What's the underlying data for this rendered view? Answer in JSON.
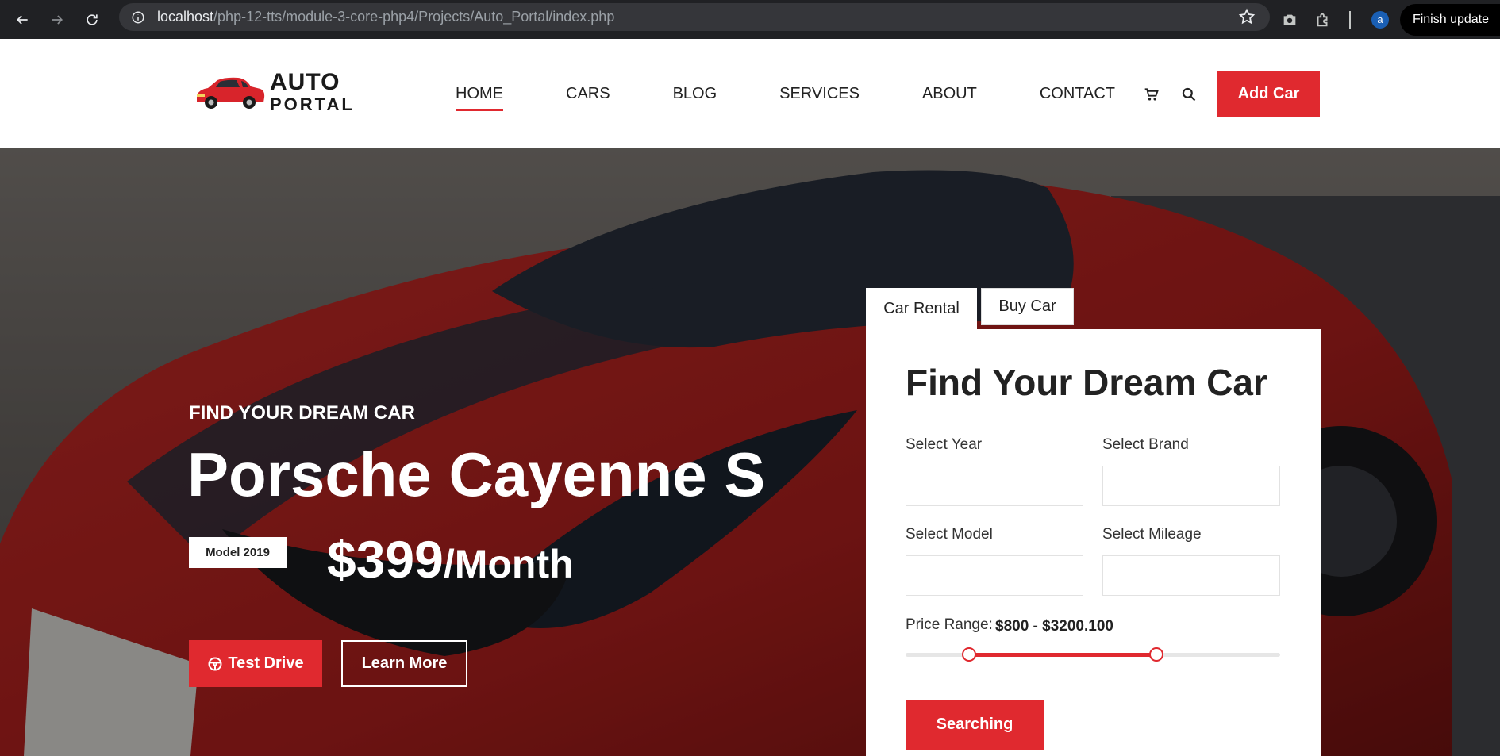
{
  "browser": {
    "url_host": "localhost",
    "url_path": "/php-12-tts/module-3-core-php4/Projects/Auto_Portal/index.php",
    "profile_initial": "a",
    "finish_update": "Finish update"
  },
  "header": {
    "logo_line1": "AUTO",
    "logo_line2": "PORTAL",
    "nav": [
      "HOME",
      "CARS",
      "BLOG",
      "SERVICES",
      "ABOUT",
      "CONTACT"
    ],
    "active_nav": "HOME",
    "add_car": "Add Car"
  },
  "hero": {
    "eyebrow": "FIND YOUR DREAM CAR",
    "headline": "Porsche Cayenne S",
    "model_badge": "Model 2019",
    "price_amount": "$399",
    "price_period": "/Month",
    "test_drive": "Test Drive",
    "learn_more": "Learn More"
  },
  "search": {
    "tabs": [
      "Car Rental",
      "Buy Car"
    ],
    "active_tab": "Car Rental",
    "title": "Find Your Dream Car",
    "fields": {
      "year": "Select Year",
      "brand": "Select Brand",
      "model": "Select Model",
      "mileage": "Select Mileage"
    },
    "price_range_label": "Price Range:",
    "price_range_value": "$800 - $3200.100",
    "range_low_fraction": 0.17,
    "range_high_fraction": 0.67,
    "submit": "Searching"
  },
  "colors": {
    "accent": "#e0292f",
    "chrome_bg": "#202124"
  }
}
